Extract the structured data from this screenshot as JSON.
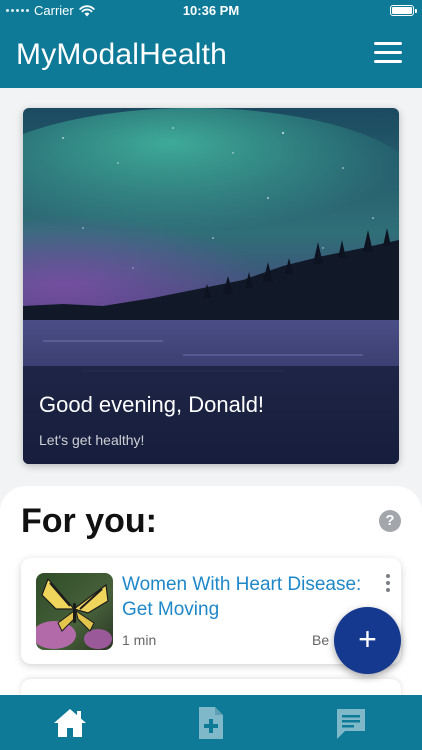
{
  "status_bar": {
    "carrier": "Carrier",
    "time": "10:36 PM"
  },
  "header": {
    "title": "MyModalHealth",
    "menu_icon": "hamburger-menu-icon"
  },
  "hero": {
    "greeting": "Good evening, Donald!",
    "subtitle": "Let's get healthy!"
  },
  "for_you": {
    "title": "For you:",
    "help_icon": "?",
    "articles": [
      {
        "title": "Women With Heart Disease: Get Moving",
        "duration": "1 min",
        "tag": "Be"
      }
    ]
  },
  "fab": {
    "label": "+"
  },
  "bottom_nav": [
    {
      "name": "home",
      "icon": "home-icon",
      "active": true
    },
    {
      "name": "records",
      "icon": "medical-document-icon",
      "active": false
    },
    {
      "name": "messages",
      "icon": "chat-icon",
      "active": false
    }
  ],
  "colors": {
    "brand": "#0e7a98",
    "fab": "#15398f",
    "link": "#1f88c9"
  }
}
